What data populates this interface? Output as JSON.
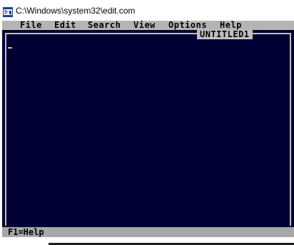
{
  "window": {
    "title": "C:\\Windows\\system32\\edit.com",
    "icon": "dos-app-icon"
  },
  "menubar": {
    "items": [
      {
        "label": "File"
      },
      {
        "label": "Edit"
      },
      {
        "label": "Search"
      },
      {
        "label": "View"
      },
      {
        "label": "Options"
      },
      {
        "label": "Help"
      }
    ]
  },
  "editor": {
    "document_title": "UNTITLED1"
  },
  "statusbar": {
    "text": "F1=Help"
  },
  "colors": {
    "console_bg": "#000033",
    "menubar_bg": "#b4b4b4",
    "statusbar_bg": "#a8a8a8"
  }
}
